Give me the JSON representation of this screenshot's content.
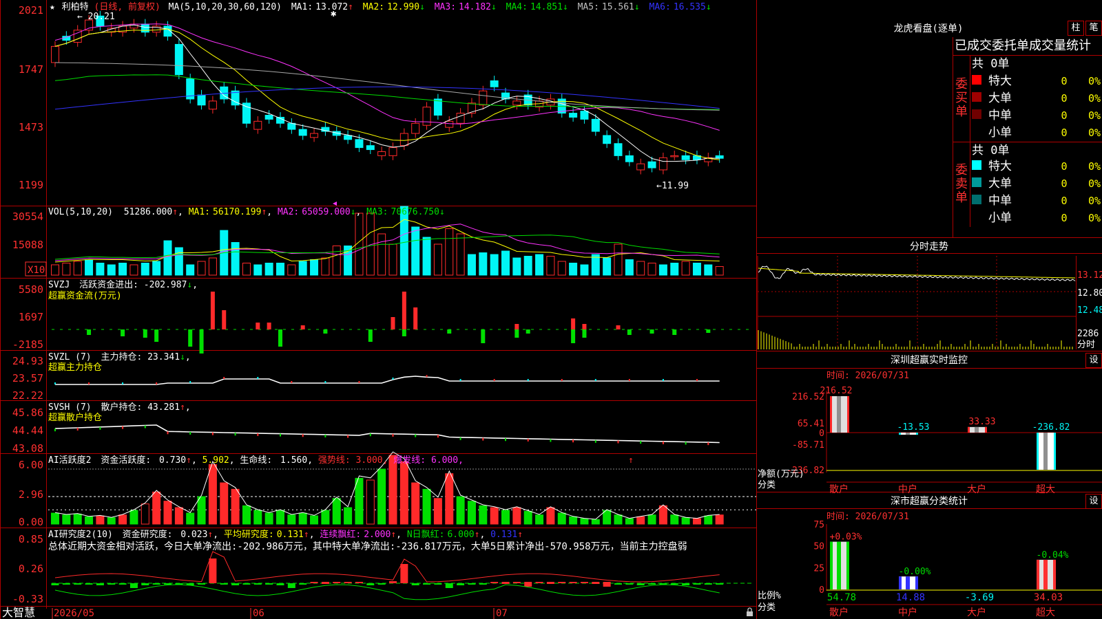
{
  "app": {
    "brand": "大智慧",
    "lock_icon": "lock-icon"
  },
  "colors": {
    "up": "#ff2a2a",
    "down": "#00f5f5",
    "grid": "#a00000",
    "white": "#ffffff",
    "yellow": "#ffff00",
    "magenta": "#ff33ff",
    "green": "#00dd00",
    "blue": "#3333ff",
    "gray": "#a8a8a8",
    "greenbar": "#00e000"
  },
  "kline": {
    "star": "★",
    "name": "利柏特",
    "period": "(日线, 前复权)",
    "ma_params": "MA(5,10,20,30,60,120)",
    "ma": [
      {
        "label": "MA1:",
        "value": "13.072",
        "arrow": "↑",
        "color": "#ffffff"
      },
      {
        "label": "MA2:",
        "value": "12.990",
        "arrow": "↓",
        "color": "#ffff00"
      },
      {
        "label": "MA3:",
        "value": "14.182",
        "arrow": "↓",
        "color": "#ff33ff"
      },
      {
        "label": "MA4:",
        "value": "14.851",
        "arrow": "↓",
        "color": "#00dd00"
      },
      {
        "label": "MA5:",
        "value": "15.561",
        "arrow": "↓",
        "color": "#c0c0c0"
      },
      {
        "label": "MA6:",
        "value": "16.535",
        "arrow": "↓",
        "color": "#3333ff"
      }
    ],
    "y_labels": [
      "2021",
      "1747",
      "1473",
      "1199"
    ],
    "high_mark": "20.21",
    "low_mark": "←11.99"
  },
  "volume": {
    "title": "VOL(5,10,20)",
    "value": "51286.000",
    "value_arrow": "↑",
    "ma": [
      {
        "label": "MA1:",
        "value": "56170.199",
        "arrow": "↑",
        "color": "#ffff00"
      },
      {
        "label": "MA2:",
        "value": "65059.000",
        "arrow": "↓",
        "color": "#ff33ff"
      },
      {
        "label": "MA3:",
        "value": "70676.750",
        "arrow": "↓",
        "color": "#00dd00"
      }
    ],
    "y_labels": [
      "30554",
      "15088"
    ],
    "unit": "X10",
    "bars": [
      6,
      7,
      8,
      9,
      7,
      6,
      7,
      6,
      7,
      8,
      20,
      16,
      6,
      8,
      10,
      26,
      19,
      7,
      6,
      7,
      7,
      6,
      8,
      9,
      10,
      17,
      17,
      36,
      36,
      24,
      18,
      40,
      28,
      22,
      18,
      27,
      24,
      12,
      13,
      12,
      14,
      10,
      11,
      12,
      11,
      8,
      7,
      6,
      12,
      10,
      18,
      9,
      8,
      7,
      6,
      7,
      8,
      7,
      6,
      5
    ],
    "bar_up": [
      1,
      1,
      1,
      0,
      0,
      0,
      0,
      1,
      0,
      0,
      0,
      0,
      0,
      1,
      1,
      0,
      0,
      1,
      0,
      0,
      0,
      1,
      0,
      0,
      1,
      1,
      0,
      1,
      1,
      1,
      1,
      0,
      0,
      0,
      1,
      1,
      1,
      0,
      0,
      0,
      0,
      0,
      0,
      0,
      1,
      1,
      0,
      0,
      0,
      0,
      1,
      0,
      1,
      1,
      0,
      0,
      1,
      0,
      0,
      1
    ]
  },
  "svzj": {
    "title": "SVZJ",
    "label": "活跃资金进出:",
    "value": "-202.987",
    "arrow": "↓",
    "sub": "超赢资金流(万元)",
    "y_labels": [
      "5580",
      "1697",
      "-2185"
    ],
    "values": [
      0,
      0,
      0,
      -8,
      0,
      0,
      -10,
      0,
      -12,
      -18,
      0,
      0,
      -25,
      -35,
      0,
      0,
      0,
      6,
      0,
      0,
      -25,
      0,
      0,
      0,
      -6,
      0,
      0,
      0,
      -18,
      0,
      0,
      -10,
      0,
      0,
      6,
      -6,
      0,
      0,
      -20,
      0,
      0,
      -12,
      -6,
      0,
      0,
      0,
      -20,
      -12,
      0,
      0,
      0,
      -8,
      0,
      -6,
      0,
      -8,
      0,
      0,
      -5,
      0
    ],
    "pos": [
      0,
      0,
      0,
      0,
      0,
      0,
      0,
      0,
      0,
      0,
      0,
      0,
      0,
      0,
      55,
      28,
      0,
      0,
      10,
      10,
      0,
      0,
      6,
      0,
      0,
      0,
      0,
      0,
      0,
      0,
      18,
      55,
      32,
      0,
      0,
      0,
      0,
      0,
      0,
      0,
      0,
      8,
      0,
      0,
      0,
      0,
      16,
      8,
      0,
      0,
      6,
      0,
      0,
      0,
      0,
      0,
      0,
      0,
      0,
      0
    ]
  },
  "svzl": {
    "title": "SVZL (7)",
    "label": "主力持仓:",
    "value": "23.341",
    "arrow": "↓",
    "sub": "超赢主力持仓",
    "y_labels": [
      "24.93",
      "23.57",
      "22.22"
    ]
  },
  "svsh": {
    "title": "SVSH (7)",
    "label": "散户持仓:",
    "value": "43.281",
    "arrow": "↑",
    "sub": "超赢散户持仓",
    "y_labels": [
      "45.86",
      "44.44",
      "43.08"
    ]
  },
  "ai1": {
    "title": "AI活跃度2",
    "label1": "资金活跃度:",
    "v1": "0.730",
    "a1": "↑",
    "v1b": "5.902",
    "label2": "生命线:",
    "v2": "1.560",
    "strong": "强势线: 3.000",
    "burst": "爆发线: 6.000",
    "y_labels": [
      "6.00",
      "2.96",
      "0.00"
    ],
    "values": [
      1.2,
      1.0,
      1.1,
      0.8,
      0.9,
      0.7,
      1.0,
      1.5,
      2.2,
      3.5,
      2.5,
      1.8,
      1.2,
      3.0,
      6.5,
      4.5,
      3.8,
      2.0,
      1.5,
      1.2,
      1.5,
      1.0,
      1.2,
      0.9,
      1.5,
      2.8,
      1.8,
      5.0,
      4.8,
      6.0,
      7.5,
      6.8,
      4.5,
      3.8,
      2.8,
      5.5,
      3.0,
      2.5,
      2.0,
      1.8,
      1.5,
      1.8,
      1.4,
      1.0,
      1.8,
      1.2,
      0.8,
      0.6,
      0.5,
      1.5,
      1.0,
      0.6,
      0.8,
      1.0,
      2.0,
      1.0,
      0.7,
      0.6,
      0.9,
      1.0
    ],
    "up": [
      0,
      0,
      0,
      0,
      1,
      0,
      1,
      0,
      1,
      1,
      1,
      1,
      0,
      0,
      1,
      1,
      1,
      0,
      0,
      0,
      0,
      0,
      0,
      0,
      0,
      0,
      0,
      0,
      1,
      0,
      1,
      1,
      1,
      0,
      1,
      1,
      0,
      0,
      0,
      1,
      0,
      1,
      0,
      0,
      1,
      0,
      0,
      0,
      0,
      0,
      0,
      0,
      1,
      0,
      1,
      0,
      0,
      1,
      0,
      1
    ]
  },
  "ai2": {
    "title": "AI研究度2(10)",
    "label1": "资金研究度:",
    "v1": "0.023",
    "a1": "↑",
    "label2": "平均研究度:",
    "v2": "0.131",
    "a2": "↑",
    "label3": "连续飘红:",
    "v3": "2.000",
    "a3": "↑",
    "label4": "N日飘红:",
    "v4": "6.000",
    "a4": "↑",
    "v5": "0.131",
    "a5": "↑",
    "summary": "总体近期大资金相对活跃，今日大单净流出:-202.986万元，其中特大单净流出:-236.817万元，大单5日累计净出-570.958万元，当前主力控盘弱",
    "y_labels": [
      "0.85",
      "0.26",
      "-0.33"
    ]
  },
  "x_labels": [
    "2026/05",
    "06",
    "07"
  ],
  "dragon": {
    "title": "龙虎看盘(逐单)",
    "btn_col": "柱",
    "btn_pen": "笔",
    "header": "已成交委托单成交量统计",
    "buy_label": "委买单",
    "sell_label": "委卖单",
    "buy_total": "共 0单",
    "sell_total": "共 0单",
    "buy_rows": [
      {
        "label": "特大",
        "qty": "0",
        "pct": "0%",
        "color": "#ff0000"
      },
      {
        "label": "大单",
        "qty": "0",
        "pct": "0%",
        "color": "#a00000"
      },
      {
        "label": "中单",
        "qty": "0",
        "pct": "0%",
        "color": "#700000"
      },
      {
        "label": "小单",
        "qty": "0",
        "pct": "0%",
        "color": ""
      }
    ],
    "sell_rows": [
      {
        "label": "特大",
        "qty": "0",
        "pct": "0%",
        "color": "#00ffff"
      },
      {
        "label": "大单",
        "qty": "0",
        "pct": "0%",
        "color": "#009a9a"
      },
      {
        "label": "中单",
        "qty": "0",
        "pct": "0%",
        "color": "#006e6e"
      },
      {
        "label": "小单",
        "qty": "0",
        "pct": "0%",
        "color": ""
      }
    ]
  },
  "intraday": {
    "title": "分时走势",
    "y_labels": [
      "13.12",
      "12.80",
      "12.48",
      "2286"
    ],
    "unit": "分时"
  },
  "monitor": {
    "title": "深圳超赢实时监控",
    "settings": "设",
    "date": "时间: 2026/07/31",
    "y_labels": [
      "216.52",
      "65.41",
      "0",
      "-85.71",
      "-236.82"
    ],
    "axis_label": "净额(万元)",
    "axis_label2": "分类",
    "bars": [
      {
        "cat": "散户",
        "value": 216.52,
        "label": "216.52"
      },
      {
        "cat": "中户",
        "value": -13.53,
        "label": "-13.53"
      },
      {
        "cat": "大户",
        "value": 33.33,
        "label": "33.33"
      },
      {
        "cat": "超大",
        "value": -236.82,
        "label": "-236.82"
      }
    ],
    "ymax": 216.52,
    "ymin": -236.82
  },
  "classify": {
    "title": "深市超赢分类统计",
    "settings": "设",
    "date": "时间: 2026/07/31",
    "y_labels": [
      "75",
      "50",
      "25",
      "0"
    ],
    "axis_label": "比例%",
    "axis_label2": "分类",
    "bars": [
      {
        "cat": "散户",
        "value": 54.78,
        "top": "+0.03%",
        "bottom": "54.78"
      },
      {
        "cat": "中户",
        "value": 14.88,
        "top": "-0.00%",
        "bottom": "14.88"
      },
      {
        "cat": "大户",
        "value": -3.69,
        "top": "",
        "bottom": "-3.69"
      },
      {
        "cat": "超大",
        "value": 34.03,
        "top": "-0.04%",
        "bottom": "34.03"
      }
    ],
    "ymax": 75
  }
}
